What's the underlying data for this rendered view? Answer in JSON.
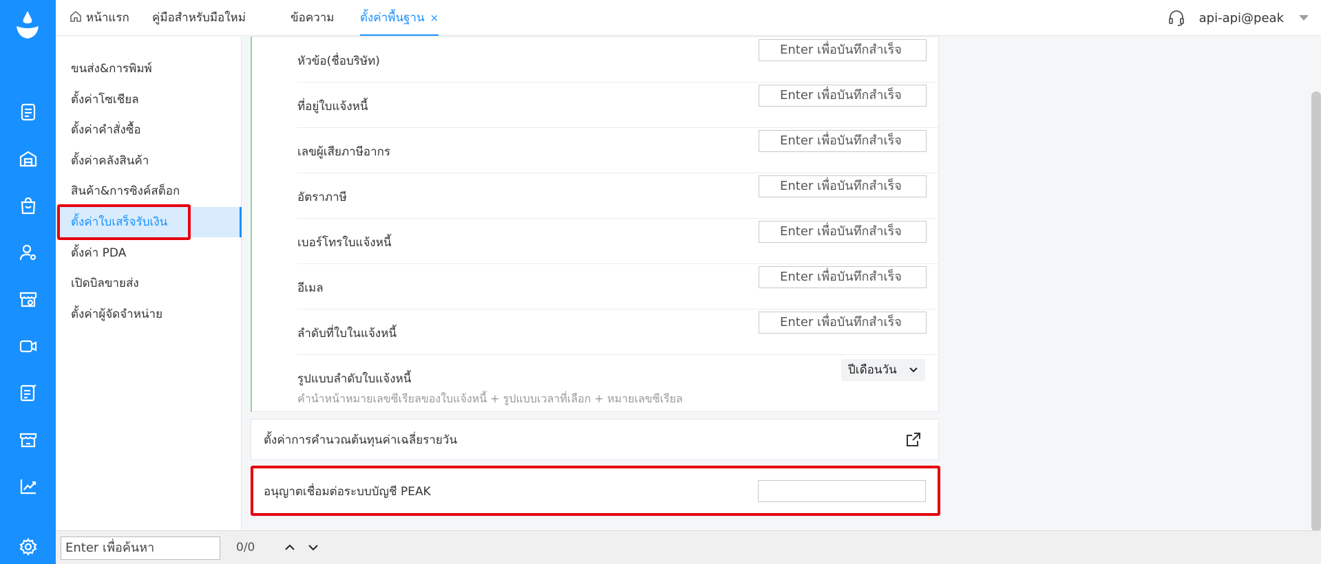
{
  "colors": {
    "brand": "#1890ff",
    "highlight": "#e5000f",
    "rail_bg": "#1890ff"
  },
  "rail": {
    "icons": [
      "document-icon",
      "warehouse-icon",
      "shopping-bag-icon",
      "user-settings-icon",
      "store-settings-icon",
      "video-icon",
      "edit-list-icon",
      "storefront-icon",
      "chart-trend-icon",
      "settings-gear-icon"
    ]
  },
  "topbar": {
    "tabs": [
      {
        "label": "หน้าแรก",
        "icon": "home-icon"
      },
      {
        "label": "คู่มือสำหรับมือใหม่"
      },
      {
        "label": "ข้อความ"
      },
      {
        "label": "ตั้งค่าพื้นฐาน",
        "active": true,
        "closable": true
      }
    ],
    "close_glyph": "×",
    "user": "api-api@peak"
  },
  "sidebar": {
    "items": [
      {
        "label": "ขนส่ง&การพิมพ์"
      },
      {
        "label": "ตั้งค่าโซเชียล"
      },
      {
        "label": "ตั้งค่าคำสั่งซื้อ"
      },
      {
        "label": "ตั้งค่าคลังสินค้า"
      },
      {
        "label": "สินค้า&การซิงค์สต็อก"
      },
      {
        "label": "ตั้งค่าใบเสร็จรับเงิน",
        "active": true
      },
      {
        "label": "ตั้งค่า PDA"
      },
      {
        "label": "เปิดบิลขายส่ง"
      },
      {
        "label": "ตั้งค่าผู้จัดจำหน่าย"
      }
    ]
  },
  "invoice_settings": {
    "fields": [
      {
        "label": "หัวข้อ(ชื่อบริษัท)",
        "placeholder": "Enter เพื่อบันทึกสำเร็จ"
      },
      {
        "label": "ที่อยู่ใบแจ้งหนี้",
        "placeholder": "Enter เพื่อบันทึกสำเร็จ"
      },
      {
        "label": "เลขผู้เสียภาษีอากร",
        "placeholder": "Enter เพื่อบันทึกสำเร็จ"
      },
      {
        "label": "อัตราภาษี",
        "placeholder": "Enter เพื่อบันทึกสำเร็จ"
      },
      {
        "label": "เบอร์โทรใบแจ้งหนี้",
        "placeholder": "Enter เพื่อบันทึกสำเร็จ"
      },
      {
        "label": "อีเมล",
        "placeholder": "Enter เพื่อบันทึกสำเร็จ"
      },
      {
        "label": "ลำดับที่ใบในแจ้งหนี้",
        "placeholder": "Enter เพื่อบันทึกสำเร็จ"
      }
    ],
    "format": {
      "label": "รูปแบบลำดับใบแจ้งหนี้",
      "selected": "ปีเดือนวัน",
      "hint": "คำนำหน้าหมายเลขซีเรียลของใบแจ้งหนี้ + รูปแบบเวลาที่เลือก + หมายเลขซีเรียล"
    }
  },
  "cost_card": {
    "label": "ตั้งค่าการคำนวณต้นทุนค่าเฉลี่ยรายวัน",
    "icon": "external-link-icon"
  },
  "peak_card": {
    "label": "อนุญาตเชื่อมต่อระบบบัญชี PEAK",
    "value": ""
  },
  "bottombar": {
    "search_placeholder": "Enter เพื่อค้นหา",
    "count": "0/0"
  }
}
